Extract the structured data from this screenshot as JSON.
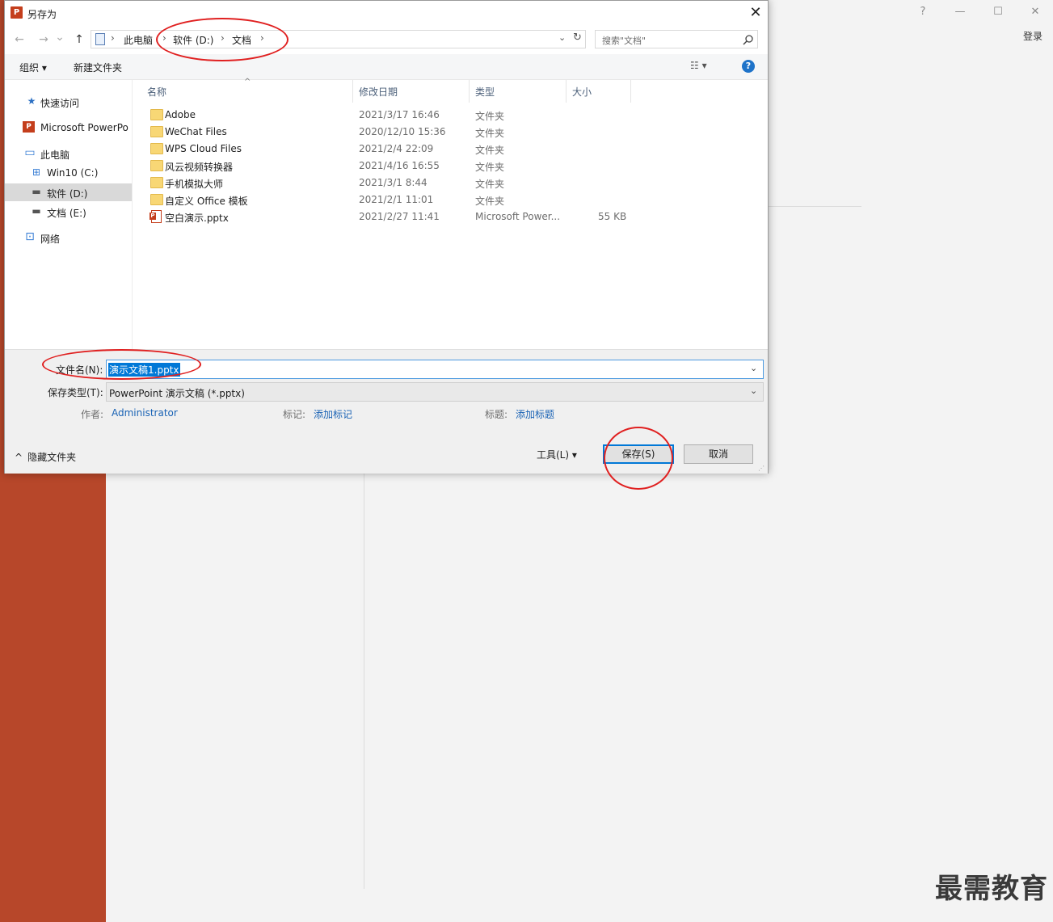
{
  "powerpoint": {
    "login_label": "登录",
    "help_glyph": "?",
    "min_glyph": "—",
    "max_glyph": "☐",
    "close_glyph": "✕",
    "watermark": "最需教育",
    "accent_color": "#b7472a"
  },
  "dialog": {
    "title": "另存为",
    "app_icon_letter": "P",
    "close_glyph": "✕",
    "nav": {
      "back_glyph": "←",
      "forward_glyph": "→",
      "recent_glyph": "⌄",
      "up_glyph": "↑"
    },
    "breadcrumb": [
      {
        "label": "此电脑"
      },
      {
        "label": "软件 (D:)"
      },
      {
        "label": "文档"
      }
    ],
    "breadcrumb_sep": "›",
    "addr_dropdown_glyph": "⌄",
    "refresh_glyph": "↻",
    "search": {
      "placeholder": "搜索\"文档\"",
      "icon": "search-icon"
    },
    "toolbar": {
      "organize": "组织 ▾",
      "new_folder": "新建文件夹",
      "view_glyph": "☷ ▾",
      "help_glyph": "?"
    },
    "sidebar": [
      {
        "label": "快速访问",
        "icon": "★",
        "color": "#2b6fc2"
      },
      {
        "label": "Microsoft PowerPo",
        "icon": "P",
        "color": "#c43e1c"
      },
      {
        "label": "此电脑",
        "icon": "▭",
        "color": "#3a7fd5"
      },
      {
        "label": "Win10 (C:)",
        "icon": "⊞",
        "color": "#3a7fd5"
      },
      {
        "label": "软件 (D:)",
        "icon": "▬",
        "color": "#555555",
        "selected": true
      },
      {
        "label": "文档 (E:)",
        "icon": "▬",
        "color": "#555555"
      },
      {
        "label": "网络",
        "icon": "⊡",
        "color": "#3a7fd5"
      }
    ],
    "columns": {
      "name": "名称",
      "date": "修改日期",
      "type": "类型",
      "size": "大小",
      "sort_glyph": "^"
    },
    "files": [
      {
        "name": "Adobe",
        "date": "2021/3/17 16:46",
        "type": "文件夹",
        "size": "",
        "kind": "folder"
      },
      {
        "name": "WeChat Files",
        "date": "2020/12/10 15:36",
        "type": "文件夹",
        "size": "",
        "kind": "folder"
      },
      {
        "name": "WPS Cloud Files",
        "date": "2021/2/4 22:09",
        "type": "文件夹",
        "size": "",
        "kind": "folder"
      },
      {
        "name": "风云视频转换器",
        "date": "2021/4/16 16:55",
        "type": "文件夹",
        "size": "",
        "kind": "folder"
      },
      {
        "name": "手机模拟大师",
        "date": "2021/3/1 8:44",
        "type": "文件夹",
        "size": "",
        "kind": "folder"
      },
      {
        "name": "自定义 Office 模板",
        "date": "2021/2/1 11:01",
        "type": "文件夹",
        "size": "",
        "kind": "folder"
      },
      {
        "name": "空白演示.pptx",
        "date": "2021/2/27 11:41",
        "type": "Microsoft Power...",
        "size": "55 KB",
        "kind": "pptx"
      }
    ],
    "filename_label": "文件名(N):",
    "filename_value": "演示文稿1.pptx",
    "filetype_label": "保存类型(T):",
    "filetype_value": "PowerPoint 演示文稿 (*.pptx)",
    "dropdown_glyph": "⌄",
    "author_label": "作者:",
    "author_value": "Administrator",
    "tags_label": "标记:",
    "tags_value": "添加标记",
    "title_label": "标题:",
    "title_value": "添加标题",
    "hide_folders": "隐藏文件夹",
    "hide_folders_glyph": "^",
    "tools": "工具(L)  ▾",
    "save": "保存(S)",
    "cancel": "取消",
    "grip_glyph": "⋰"
  }
}
